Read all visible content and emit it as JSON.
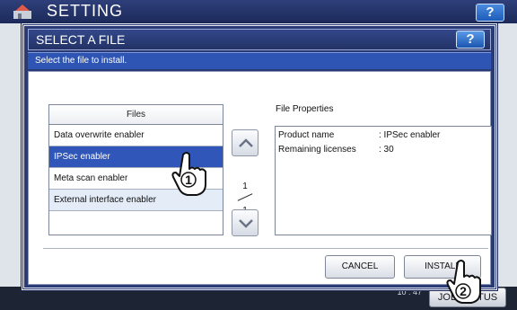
{
  "background": {
    "title": "SETTING",
    "help_label": "?",
    "clock": "10 : 47",
    "job_status_label": "JOB STATUS"
  },
  "dialog": {
    "title": "SELECT A FILE",
    "help_label": "?",
    "instruction": "Select the file to install.",
    "files": {
      "header": "Files",
      "items": [
        {
          "label": "Data overwrite enabler",
          "selected": false
        },
        {
          "label": "IPSec enabler",
          "selected": true
        },
        {
          "label": "Meta scan enabler",
          "selected": false
        },
        {
          "label": "External interface enabler",
          "selected": false
        }
      ]
    },
    "pagination": {
      "current": "1",
      "total": "1"
    },
    "properties": {
      "label": "File Properties",
      "rows": [
        {
          "key": "Product name",
          "value": ": IPSec enabler"
        },
        {
          "key": "Remaining licenses",
          "value": ": 30"
        }
      ]
    },
    "buttons": {
      "cancel": "CANCEL",
      "install": "INSTALL"
    }
  },
  "callouts": {
    "step1": "1",
    "step2": "2"
  },
  "colors": {
    "dialog_bg": "#2a3a74",
    "selection": "#2f56b8",
    "instruction_bar": "#2e55b4"
  }
}
